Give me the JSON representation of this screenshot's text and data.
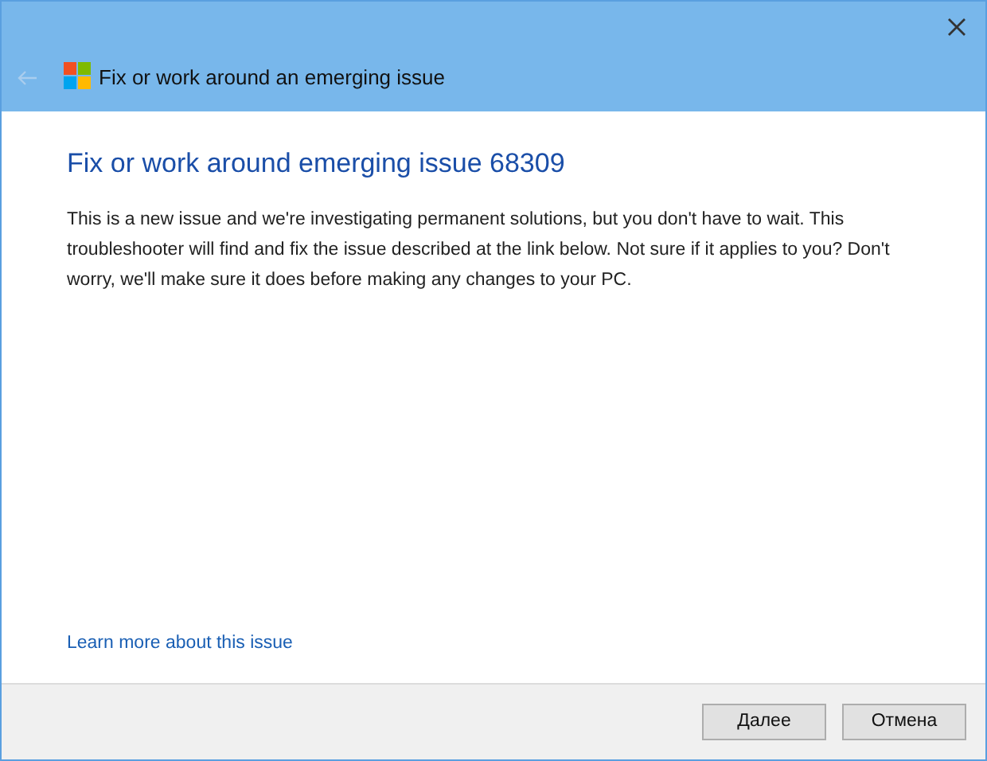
{
  "window": {
    "title": "Fix or work around an emerging issue"
  },
  "heading": "Fix or work around emerging issue 68309",
  "description": "This is a new issue and we're investigating permanent solutions, but you don't have to wait.  This troubleshooter will find and fix the issue described at the link below.  Not sure if it applies to you? Don't worry, we'll make sure it does before making any changes to your PC.",
  "link": "Learn more about this issue",
  "buttons": [
    "Далее",
    "Отмена"
  ]
}
